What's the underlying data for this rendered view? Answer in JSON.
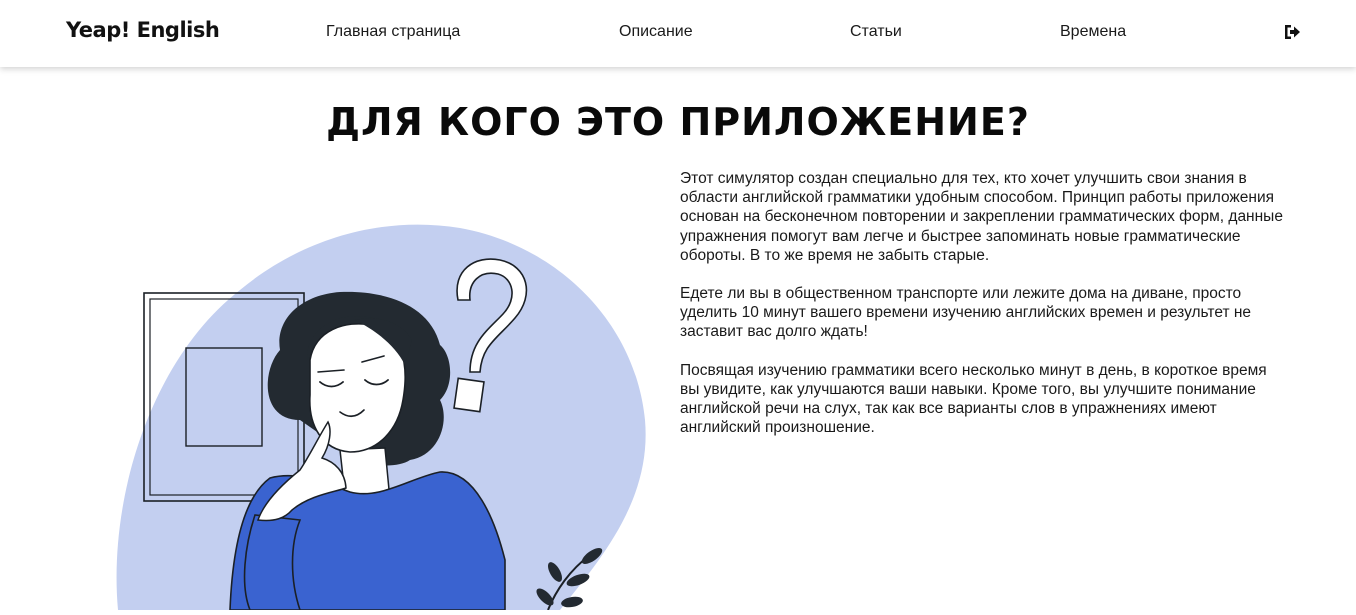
{
  "header": {
    "logo": "Yeap! English",
    "nav": [
      {
        "label": "Главная страница"
      },
      {
        "label": "Описание"
      },
      {
        "label": "Статьи"
      },
      {
        "label": "Времена"
      }
    ],
    "logout_icon": "sign-out-icon"
  },
  "main": {
    "title": "ДЛЯ КОГО ЭТО ПРИЛОЖЕНИЕ?",
    "paragraphs": [
      "Этот симулятор создан специально для тех, кто хочет улучшить свои знания в области английской грамматики удобным способом. Принцип работы приложения основан на бесконечном повторении и закреплении грамматических форм, данные упражнения помогут вам легче и быстрее запоминать новые грамматические обороты. В то же время не забыть старые.",
      "Едете ли вы в общественном транспорте или лежите дома на диване, просто уделить 10 минут вашего времени изучению английских времен и результет не заставит вас долго ждать!",
      "Посвящая изучению грамматики всего несколько минут в день, в короткое время вы увидите, как улучшаются ваши навыки. Кроме того, вы улучшите понимание английской речи на слух, так как все варианты слов в упражнениях имеют английский произношение."
    ]
  },
  "colors": {
    "blob": "#c3cff0",
    "sweater": "#3a63d0",
    "hair": "#232a31",
    "line": "#1b2026"
  }
}
